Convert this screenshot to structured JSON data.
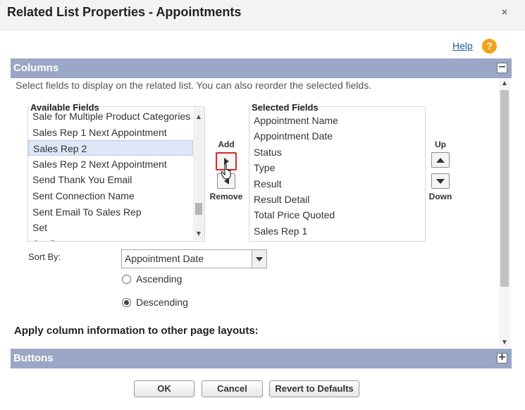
{
  "dialog": {
    "title": "Related List Properties - Appointments",
    "close_icon": "close-icon",
    "close_glyph": "×"
  },
  "help": {
    "label": "Help",
    "icon": "help-icon",
    "glyph": "?"
  },
  "sections": {
    "columns": {
      "title": "Columns",
      "toggle": "−",
      "toggle_icon": "collapse-icon"
    },
    "buttons": {
      "title": "Buttons",
      "toggle": "+",
      "toggle_icon": "expand-icon"
    }
  },
  "instructions": "Select fields to display on the related list. You can also reorder the selected fields.",
  "available": {
    "label": "Available Fields",
    "items": [
      "Sale for Multiple Product Categories",
      "Sales Rep 1 Next Appointment",
      "Sales Rep 2",
      "Sales Rep 2 Next Appointment",
      "Send Thank You Email",
      "Sent Connection Name",
      "Sent Email To Sales Rep",
      "Set",
      "Set By"
    ],
    "selected_item": "Sales Rep 2"
  },
  "selected": {
    "label": "Selected Fields",
    "items": [
      "Appointment Name",
      "Appointment Date",
      "Status",
      "Type",
      "Result",
      "Result Detail",
      "Total Price Quoted",
      "Sales Rep 1"
    ]
  },
  "controls": {
    "add": "Add",
    "remove": "Remove",
    "up": "Up",
    "down": "Down"
  },
  "sort": {
    "label": "Sort By:",
    "value": "Appointment Date",
    "ascending": "Ascending",
    "descending": "Descending",
    "selected_order": "Descending"
  },
  "apply_heading": "Apply column information to other page layouts:",
  "footer": {
    "ok": "OK",
    "cancel": "Cancel",
    "revert": "Revert to Defaults"
  },
  "colors": {
    "section_header": "#9aa7c6",
    "link": "#1a5d99",
    "help_icon": "#f4a21a",
    "highlight_border": "#d9262b"
  }
}
